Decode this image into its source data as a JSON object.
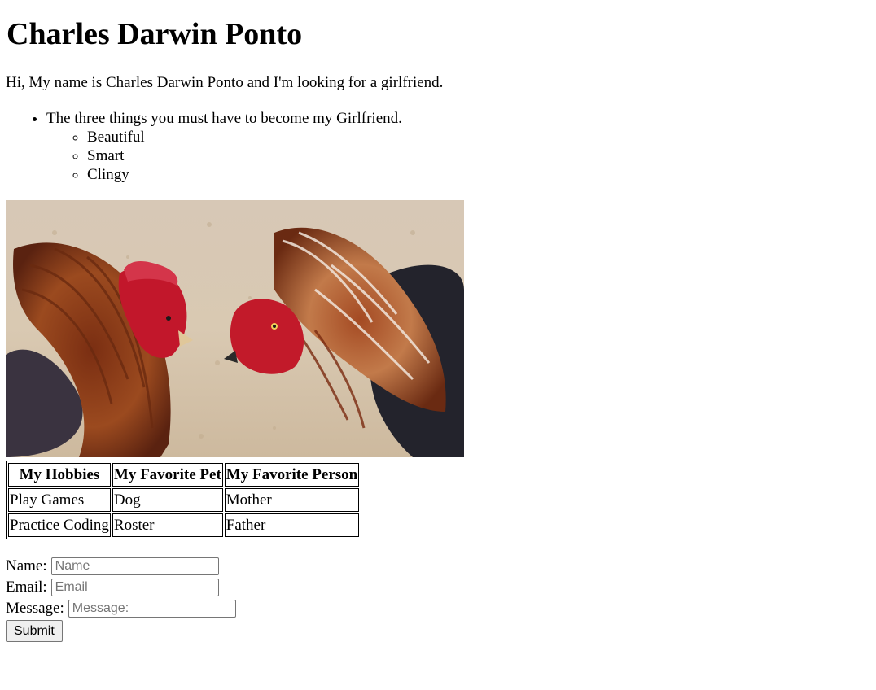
{
  "page": {
    "title": "Charles Darwin Ponto",
    "intro": "Hi, My name is Charles Darwin Ponto and I'm looking for a girlfriend.",
    "requirements_heading": "The three things you must have to become my Girlfriend.",
    "requirements": [
      "Beautiful",
      "Smart",
      "Clingy"
    ]
  },
  "image": {
    "subject": "two fighting roosters"
  },
  "table": {
    "headers": [
      "My Hobbies",
      "My Favorite Pet",
      "My Favorite Person"
    ],
    "rows": [
      [
        "Play Games",
        "Dog",
        "Mother"
      ],
      [
        "Practice Coding",
        "Roster",
        "Father"
      ]
    ]
  },
  "form": {
    "name_label": "Name:",
    "name_placeholder": "Name",
    "email_label": "Email:",
    "email_placeholder": "Email",
    "message_label": "Message:",
    "message_placeholder": "Message:",
    "submit_label": "Submit"
  }
}
